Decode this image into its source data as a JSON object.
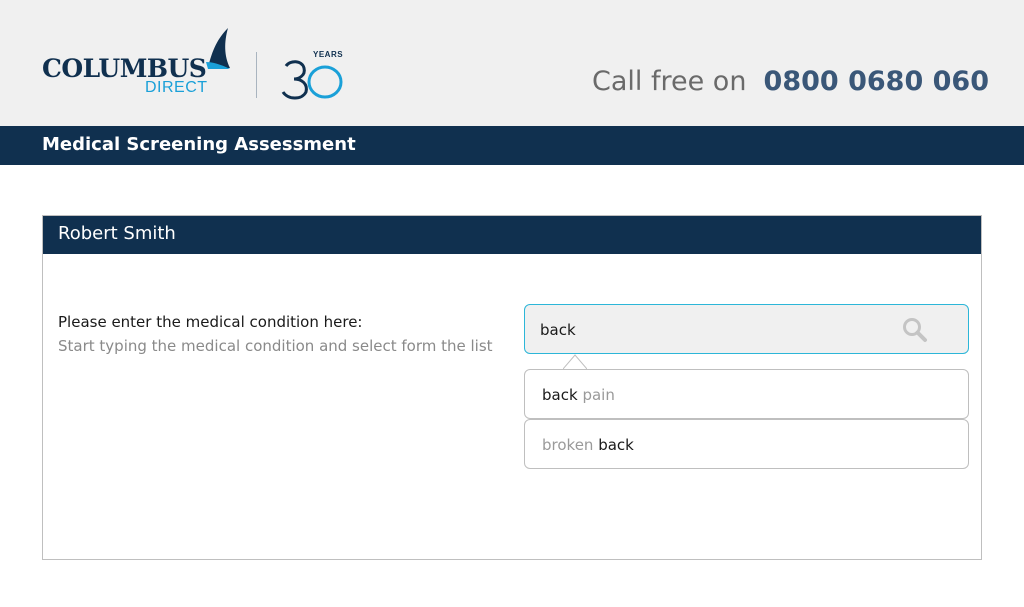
{
  "header": {
    "logo": {
      "brand": "COLUMBUS",
      "sub": "DIRECT",
      "years_label": "YEARS",
      "years_number": "30"
    },
    "call_label": "Call free on",
    "call_number": "0800 0680 060"
  },
  "titlebar": {
    "title": "Medical Screening Assessment"
  },
  "card": {
    "name": "Robert Smith",
    "question_label": "Please enter the medical condition here:",
    "question_hint": "Start typing the medical condition and select form the list",
    "search": {
      "value": "back"
    },
    "suggestions": [
      {
        "first": "back",
        "second": "pain",
        "first_matched": true
      },
      {
        "first": "broken",
        "second": "back",
        "first_matched": false
      }
    ]
  },
  "colors": {
    "navy": "#10304f",
    "accent_blue": "#1aa0d8",
    "input_border": "#2cb6d8",
    "header_bg": "#f0f0f0"
  },
  "icons": {
    "search": "search-icon"
  }
}
